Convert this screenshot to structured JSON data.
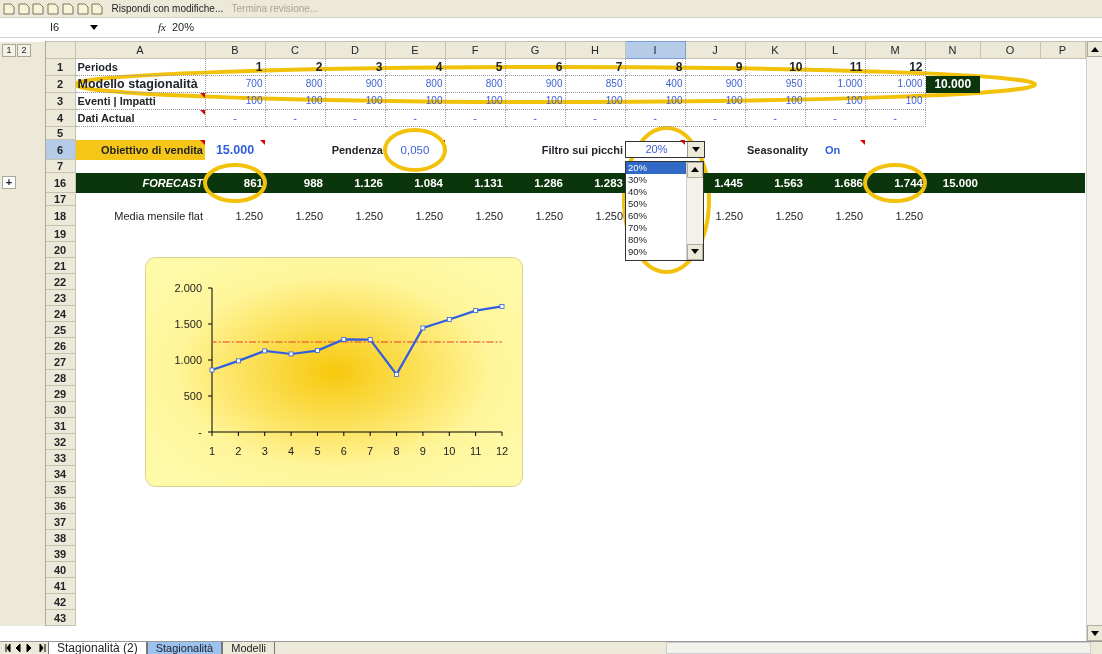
{
  "toolbar": {
    "items": [
      {
        "label": "Rispondi con modifiche...",
        "disabled": false
      },
      {
        "label": "Termina revisione...",
        "disabled": true
      }
    ]
  },
  "formula_bar": {
    "name_box": "I6",
    "function_label": "fx",
    "formula": "20%"
  },
  "outline_levels": [
    "1",
    "2"
  ],
  "columns": [
    {
      "label": "A",
      "selected": false
    },
    {
      "label": "B",
      "selected": false
    },
    {
      "label": "C",
      "selected": false
    },
    {
      "label": "D",
      "selected": false
    },
    {
      "label": "E",
      "selected": false
    },
    {
      "label": "F",
      "selected": false
    },
    {
      "label": "G",
      "selected": false
    },
    {
      "label": "H",
      "selected": false
    },
    {
      "label": "I",
      "selected": true
    },
    {
      "label": "J",
      "selected": false
    },
    {
      "label": "K",
      "selected": false
    },
    {
      "label": "L",
      "selected": false
    },
    {
      "label": "M",
      "selected": false
    },
    {
      "label": "N",
      "selected": false
    },
    {
      "label": "O",
      "selected": false
    },
    {
      "label": "P",
      "selected": false
    }
  ],
  "rows": [
    {
      "number": "1",
      "kind": "grid",
      "selected": false,
      "cells": [
        {
          "kind": "label",
          "text": "Periods"
        },
        {
          "kind": "header-number",
          "text": "1"
        },
        {
          "kind": "header-number",
          "text": "2"
        },
        {
          "kind": "header-number",
          "text": "3"
        },
        {
          "kind": "header-number",
          "text": "4"
        },
        {
          "kind": "header-number",
          "text": "5"
        },
        {
          "kind": "header-number",
          "text": "6"
        },
        {
          "kind": "header-number",
          "text": "7"
        },
        {
          "kind": "header-number",
          "text": "8"
        },
        {
          "kind": "header-number",
          "text": "9"
        },
        {
          "kind": "header-number",
          "text": "10"
        },
        {
          "kind": "header-number",
          "text": "11"
        },
        {
          "kind": "header-number",
          "text": "12"
        }
      ]
    },
    {
      "number": "2",
      "kind": "grid",
      "selected": false,
      "cells": [
        {
          "kind": "title-label",
          "text": "Modello stagionalità"
        },
        {
          "kind": "input",
          "text": "700"
        },
        {
          "kind": "input",
          "text": "800"
        },
        {
          "kind": "input",
          "text": "900"
        },
        {
          "kind": "input",
          "text": "800"
        },
        {
          "kind": "input",
          "text": "800"
        },
        {
          "kind": "input",
          "text": "900"
        },
        {
          "kind": "input",
          "text": "850"
        },
        {
          "kind": "input",
          "text": "400"
        },
        {
          "kind": "input",
          "text": "900"
        },
        {
          "kind": "input",
          "text": "950"
        },
        {
          "kind": "input",
          "text": "1.000"
        },
        {
          "kind": "input",
          "text": "1.000"
        },
        {
          "kind": "total",
          "text": "10.000"
        }
      ]
    },
    {
      "number": "3",
      "kind": "grid",
      "selected": false,
      "cells": [
        {
          "kind": "label",
          "text": "Eventi | Impatti",
          "comment": true
        },
        {
          "kind": "input",
          "text": "100"
        },
        {
          "kind": "input",
          "text": "100"
        },
        {
          "kind": "input",
          "text": "100"
        },
        {
          "kind": "input",
          "text": "100"
        },
        {
          "kind": "input",
          "text": "100"
        },
        {
          "kind": "input",
          "text": "100"
        },
        {
          "kind": "input",
          "text": "100"
        },
        {
          "kind": "input",
          "text": "100"
        },
        {
          "kind": "input",
          "text": "100"
        },
        {
          "kind": "input",
          "text": "100"
        },
        {
          "kind": "input",
          "text": "100"
        },
        {
          "kind": "input",
          "text": "100"
        }
      ]
    },
    {
      "number": "4",
      "kind": "grid",
      "selected": false,
      "cells": [
        {
          "kind": "label",
          "text": "Dati Actual",
          "comment": true
        },
        {
          "kind": "actual",
          "text": "-"
        },
        {
          "kind": "actual",
          "text": "-"
        },
        {
          "kind": "actual",
          "text": "-"
        },
        {
          "kind": "actual",
          "text": "-"
        },
        {
          "kind": "actual",
          "text": "-"
        },
        {
          "kind": "actual",
          "text": "-"
        },
        {
          "kind": "actual",
          "text": "-"
        },
        {
          "kind": "actual",
          "text": "-"
        },
        {
          "kind": "actual",
          "text": "-"
        },
        {
          "kind": "actual",
          "text": "-"
        },
        {
          "kind": "actual",
          "text": "-"
        },
        {
          "kind": "actual",
          "text": "-"
        }
      ]
    },
    {
      "number": "5",
      "kind": "short",
      "selected": false,
      "cells": []
    },
    {
      "number": "6",
      "kind": "tall",
      "selected": true,
      "cells": [
        {
          "kind": "highlight-label",
          "text": "Obiettivo di vendita",
          "comment": true
        },
        {
          "kind": "key-input",
          "text": "15.000",
          "comment": true
        },
        {
          "kind": "empty"
        },
        {
          "kind": "caption",
          "text": "Pendenza"
        },
        {
          "kind": "input-center",
          "text": "0,050",
          "comment": true
        },
        {
          "kind": "empty"
        },
        {
          "kind": "empty"
        },
        {
          "kind": "caption",
          "text": "Filtro sui picchi"
        },
        {
          "kind": "combo",
          "text": "20%",
          "comment": true
        },
        {
          "kind": "empty"
        },
        {
          "kind": "caption-left",
          "text": "Seasonality"
        },
        {
          "kind": "switch-value",
          "text": "On",
          "comment": true
        }
      ]
    },
    {
      "number": "7",
      "kind": "short",
      "selected": false,
      "cells": []
    },
    {
      "number": "16",
      "kind": "band",
      "selected": false,
      "expand_button": "+",
      "cells": [
        {
          "kind": "forecast-label",
          "text": "FORECAST"
        },
        {
          "kind": "forecast",
          "text": "861"
        },
        {
          "kind": "forecast",
          "text": "988"
        },
        {
          "kind": "forecast",
          "text": "1.126"
        },
        {
          "kind": "forecast",
          "text": "1.084"
        },
        {
          "kind": "forecast",
          "text": "1.131"
        },
        {
          "kind": "forecast",
          "text": "1.286"
        },
        {
          "kind": "forecast",
          "text": "1.283"
        },
        {
          "kind": "forecast"
        },
        {
          "kind": "forecast",
          "text": "1.445"
        },
        {
          "kind": "forecast",
          "text": "1.563"
        },
        {
          "kind": "forecast",
          "text": "1.686"
        },
        {
          "kind": "forecast",
          "text": "1.744"
        },
        {
          "kind": "forecast",
          "text": "15.000"
        }
      ]
    },
    {
      "number": "17",
      "kind": "short",
      "selected": false,
      "cells": []
    },
    {
      "number": "18",
      "kind": "tall",
      "selected": false,
      "cells": [
        {
          "kind": "plain",
          "text": "Media mensile flat"
        },
        {
          "kind": "plain",
          "text": "1.250"
        },
        {
          "kind": "plain",
          "text": "1.250"
        },
        {
          "kind": "plain",
          "text": "1.250"
        },
        {
          "kind": "plain",
          "text": "1.250"
        },
        {
          "kind": "plain",
          "text": "1.250"
        },
        {
          "kind": "plain",
          "text": "1.250"
        },
        {
          "kind": "plain",
          "text": "1.250"
        },
        {
          "kind": "empty"
        },
        {
          "kind": "plain",
          "text": "1.250"
        },
        {
          "kind": "plain",
          "text": "1.250"
        },
        {
          "kind": "plain",
          "text": "1.250"
        },
        {
          "kind": "plain",
          "text": "1.250"
        }
      ]
    },
    {
      "number": "19",
      "kind": "normal",
      "selected": false,
      "cells": []
    },
    {
      "number": "20",
      "kind": "normal",
      "selected": false,
      "cells": []
    },
    {
      "number": "21",
      "kind": "normal",
      "selected": false,
      "cells": []
    },
    {
      "number": "22",
      "kind": "normal",
      "selected": false,
      "cells": []
    },
    {
      "number": "23",
      "kind": "normal",
      "selected": false,
      "cells": []
    },
    {
      "number": "24",
      "kind": "normal",
      "selected": false,
      "cells": []
    },
    {
      "number": "25",
      "kind": "normal",
      "selected": false,
      "cells": []
    },
    {
      "number": "26",
      "kind": "normal",
      "selected": false,
      "cells": []
    },
    {
      "number": "27",
      "kind": "normal",
      "selected": false,
      "cells": []
    },
    {
      "number": "28",
      "kind": "normal",
      "selected": false,
      "cells": []
    },
    {
      "number": "29",
      "kind": "normal",
      "selected": false,
      "cells": []
    },
    {
      "number": "30",
      "kind": "normal",
      "selected": false,
      "cells": []
    },
    {
      "number": "31",
      "kind": "normal",
      "selected": false,
      "cells": []
    },
    {
      "number": "32",
      "kind": "normal",
      "selected": false,
      "cells": []
    },
    {
      "number": "33",
      "kind": "normal",
      "selected": false,
      "cells": []
    },
    {
      "number": "34",
      "kind": "normal",
      "selected": false,
      "cells": []
    },
    {
      "number": "35",
      "kind": "normal",
      "selected": false,
      "cells": []
    },
    {
      "number": "36",
      "kind": "normal",
      "selected": false,
      "cells": []
    },
    {
      "number": "37",
      "kind": "normal",
      "selected": false,
      "cells": []
    },
    {
      "number": "38",
      "kind": "normal",
      "selected": false,
      "cells": []
    },
    {
      "number": "39",
      "kind": "normal",
      "selected": false,
      "cells": []
    },
    {
      "number": "40",
      "kind": "normal",
      "selected": false,
      "cells": []
    },
    {
      "number": "41",
      "kind": "normal",
      "selected": false,
      "cells": []
    },
    {
      "number": "42",
      "kind": "normal",
      "selected": false,
      "cells": []
    },
    {
      "number": "43",
      "kind": "normal",
      "selected": false,
      "cells": []
    }
  ],
  "dropdown_list": {
    "items": [
      {
        "label": "20%",
        "selected": true
      },
      {
        "label": "30%",
        "selected": false
      },
      {
        "label": "40%",
        "selected": false
      },
      {
        "label": "50%",
        "selected": false
      },
      {
        "label": "60%",
        "selected": false
      },
      {
        "label": "70%",
        "selected": false
      },
      {
        "label": "80%",
        "selected": false
      },
      {
        "label": "90%",
        "selected": false
      }
    ]
  },
  "chart": {
    "chart_data": {
      "type": "line",
      "x": [
        1,
        2,
        3,
        4,
        5,
        6,
        7,
        8,
        9,
        10,
        11,
        12
      ],
      "xlim": [
        1,
        12
      ],
      "series": [
        {
          "color": "#2f5fe0",
          "marker": "square",
          "values": [
            861,
            988,
            1126,
            1084,
            1131,
            1286,
            1283,
            800,
            1445,
            1563,
            1686,
            1744
          ]
        },
        {
          "color": "#e0402a",
          "line_style": "dashed",
          "values": [
            1250,
            1250,
            1250,
            1250,
            1250,
            1250,
            1250,
            1250,
            1250,
            1250,
            1250,
            1250
          ]
        }
      ],
      "ylim": [
        0,
        2000
      ],
      "yticks": [
        {
          "value": 0,
          "label": "-"
        },
        {
          "value": 500,
          "label": "500"
        },
        {
          "value": 1000,
          "label": "1.000"
        },
        {
          "value": 1500,
          "label": "1.500"
        },
        {
          "value": 2000,
          "label": "2.000"
        }
      ],
      "xticks": [
        1,
        2,
        3,
        4,
        5,
        6,
        7,
        8,
        9,
        10,
        11,
        12
      ]
    }
  },
  "annotations": [
    {
      "kind": "ellipse"
    },
    {
      "kind": "ellipse"
    },
    {
      "kind": "ellipse"
    },
    {
      "kind": "ellipse"
    },
    {
      "kind": "ellipse"
    }
  ],
  "sheet_tabs": [
    {
      "label": "Stagionalità (2)",
      "selected": true
    },
    {
      "label": "Stagionalità",
      "selected": false,
      "color": "#9cc2f0"
    },
    {
      "label": "Modelli",
      "selected": false
    }
  ]
}
